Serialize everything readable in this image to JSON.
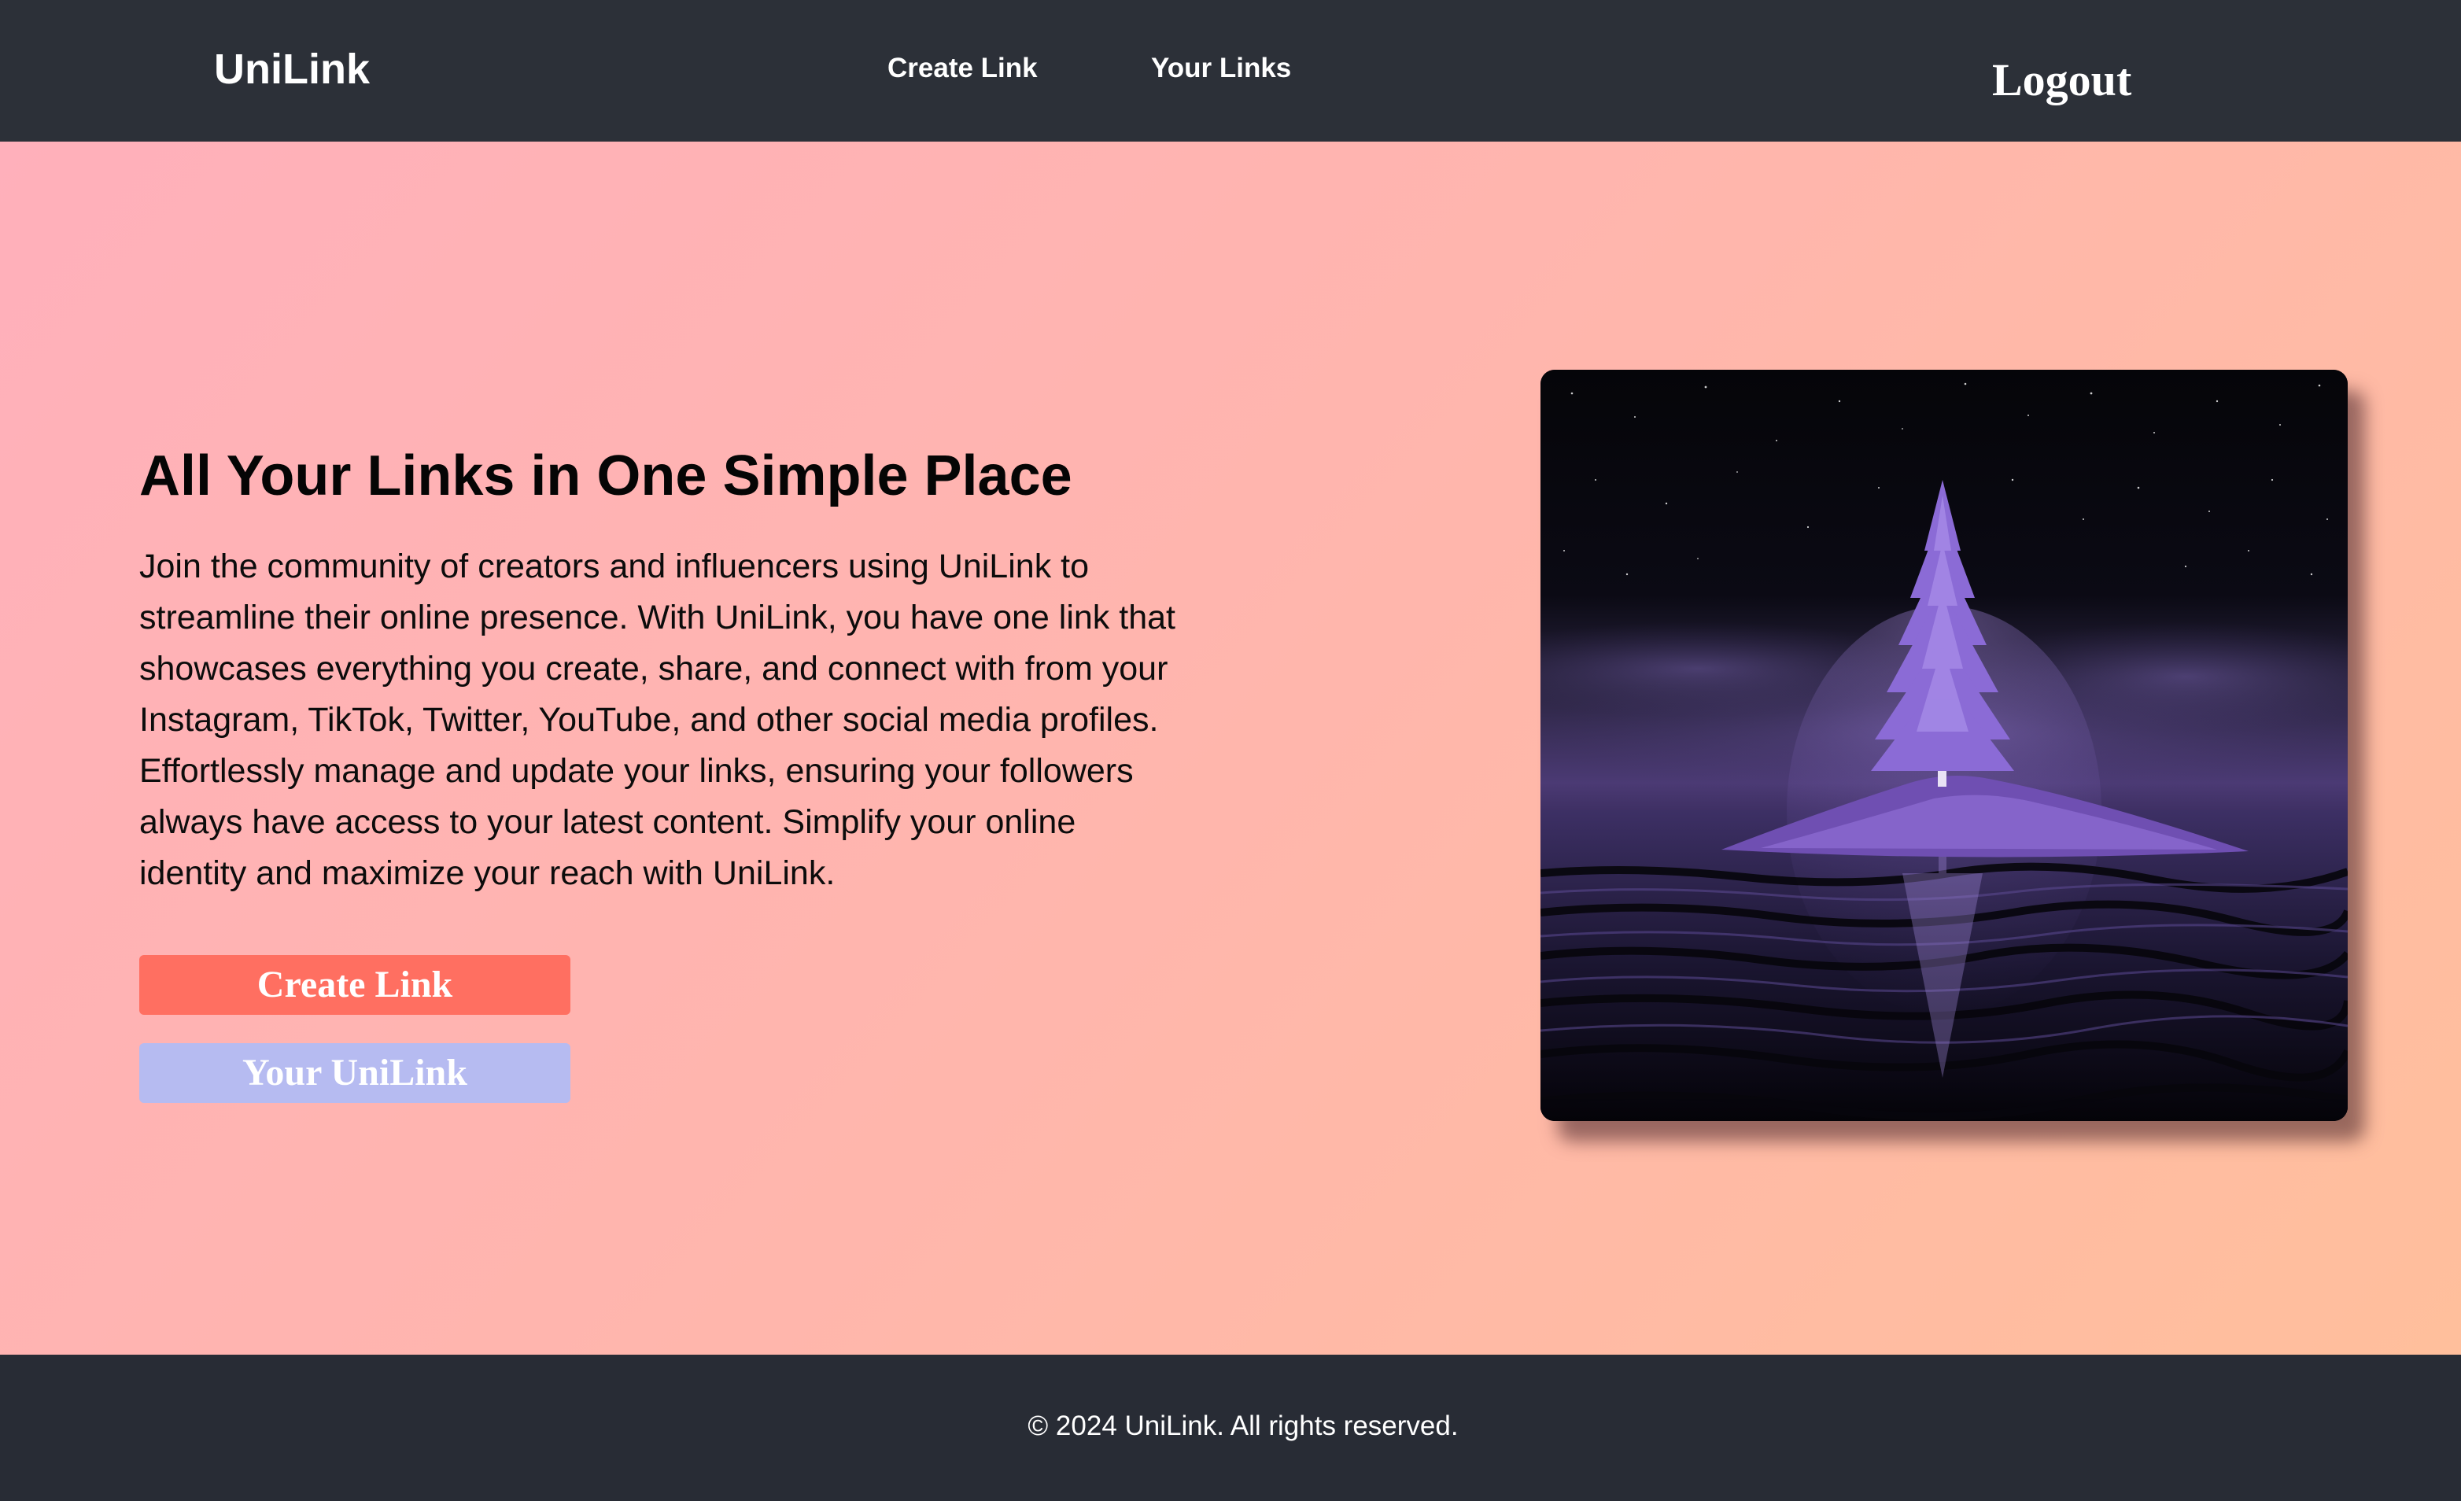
{
  "header": {
    "brand": "UniLink",
    "nav": {
      "create_link": "Create Link",
      "your_links": "Your Links"
    },
    "logout": "Logout"
  },
  "hero": {
    "title": "All Your Links in One Simple Place",
    "description": "Join the community of creators and influencers using UniLink to streamline their online presence. With UniLink, you have one link that showcases everything you create, share, and connect with from your Instagram, TikTok, Twitter, YouTube, and other social media profiles. Effortlessly manage and update your links, ensuring your followers always have access to your latest content. Simplify your online identity and maximize your reach with UniLink.",
    "primary_button": "Create Link",
    "secondary_button": "Your UniLink",
    "image_subject": "purple-tree-island-night-artwork"
  },
  "footer": {
    "copyright": "© 2024 UniLink. All rights reserved."
  },
  "colors": {
    "header_bg": "#2c3038",
    "footer_bg": "#282c35",
    "gradient_start": "#ffb0bb",
    "gradient_end": "#ffbf9c",
    "primary_button": "#ff6f61",
    "secondary_button": "#b6bbf1",
    "text_dark": "#050505",
    "text_light": "#ffffff"
  }
}
